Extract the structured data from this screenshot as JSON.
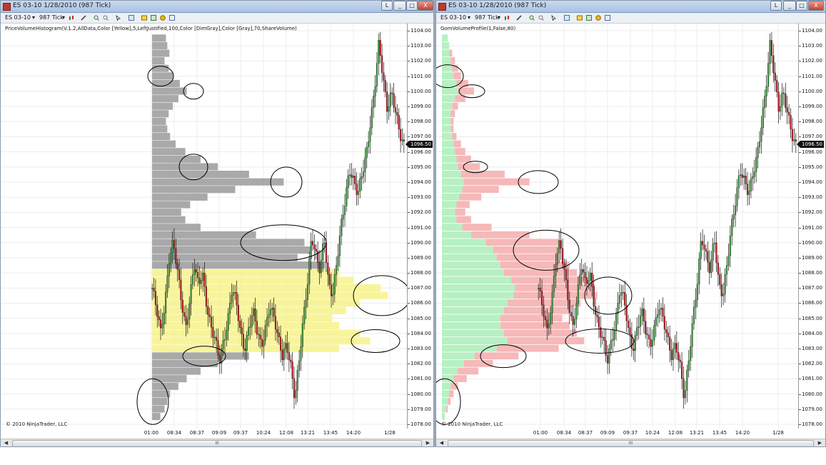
{
  "left_window": {
    "title": "ES 03-10  1/28/2010 (987 Tick)",
    "window_buttons": {
      "help": "L",
      "minimize": "_",
      "maximize": "□",
      "close": "X"
    },
    "toolbar": {
      "instrument": "ES 03-10",
      "interval": "987 Tick"
    },
    "indicator_label": "PriceVolumeHistogram(V.1.2,AllData,Color [Yellow],5,LeftJustified,100,Color [DimGray],Color [Gray],70,ShareVolume)",
    "last_price": "1096.50",
    "copyright": "© 2010 NinjaTrader, LLC",
    "scroll_thumb": "III"
  },
  "right_window": {
    "title": "ES 03-10  1/28/2010 (987 Tick)",
    "window_buttons": {
      "help": "L",
      "minimize": "_",
      "maximize": "□",
      "close": "X"
    },
    "toolbar": {
      "instrument": "ES 03-10",
      "interval": "987 Tick"
    },
    "indicator_label": "GomVolumeProfile(1,False,80)",
    "last_price": "1096.50",
    "copyright": "© 2010 NinjaTrader, LLC",
    "scroll_thumb": "III"
  },
  "colors": {
    "candle_up": "#3a9a3a",
    "candle_down": "#c0161c",
    "left_profile": "#a9a9a9",
    "left_value_area": "#f7f28a",
    "right_profile_buy": "#b7f0c3",
    "right_profile_sell": "#f6b8b8"
  },
  "chart_data": {
    "type": "candlestick",
    "price_axis_labels": [
      "1104.00",
      "1103.00",
      "1102.00",
      "1101.00",
      "1100.00",
      "1099.00",
      "1098.00",
      "1097.00",
      "1096.00",
      "1095.00",
      "1094.00",
      "1093.00",
      "1092.00",
      "1091.00",
      "1090.00",
      "1089.00",
      "1088.00",
      "1087.00",
      "1086.00",
      "1085.00",
      "1084.00",
      "1083.00",
      "1082.00",
      "1081.00",
      "1080.00",
      "1079.00",
      "1078.00"
    ],
    "ylim": [
      1078,
      1104
    ],
    "left_time_labels": [
      "01:00",
      "08:34",
      "08:37",
      "09:09",
      "09:37",
      "10:24",
      "12:08",
      "13:21",
      "13:45",
      "14:20",
      "1/28"
    ],
    "right_time_labels": [
      "01:00",
      "08:34",
      "08:37",
      "09:09",
      "09:37",
      "10:24",
      "12:08",
      "13:21",
      "13:45",
      "14:20",
      "1/28"
    ],
    "close_path": [
      [
        0,
        1087
      ],
      [
        4,
        1085.5
      ],
      [
        8,
        1084
      ],
      [
        12,
        1086
      ],
      [
        16,
        1089
      ],
      [
        20,
        1090
      ],
      [
        24,
        1088
      ],
      [
        28,
        1086
      ],
      [
        32,
        1084.5
      ],
      [
        36,
        1086.5
      ],
      [
        40,
        1088.5
      ],
      [
        44,
        1087
      ],
      [
        48,
        1088
      ],
      [
        52,
        1086
      ],
      [
        56,
        1084.5
      ],
      [
        60,
        1083.5
      ],
      [
        64,
        1082
      ],
      [
        68,
        1083.5
      ],
      [
        72,
        1085
      ],
      [
        76,
        1087
      ],
      [
        80,
        1086
      ],
      [
        84,
        1084
      ],
      [
        88,
        1083
      ],
      [
        92,
        1084.5
      ],
      [
        96,
        1085.5
      ],
      [
        100,
        1084
      ],
      [
        104,
        1083
      ],
      [
        108,
        1084.5
      ],
      [
        112,
        1086
      ],
      [
        116,
        1085
      ],
      [
        120,
        1083.5
      ],
      [
        124,
        1082.5
      ],
      [
        128,
        1083.5
      ],
      [
        132,
        1082
      ],
      [
        136,
        1079.5
      ],
      [
        140,
        1082
      ],
      [
        144,
        1085
      ],
      [
        148,
        1087.5
      ],
      [
        152,
        1090.5
      ],
      [
        156,
        1089
      ],
      [
        160,
        1088
      ],
      [
        164,
        1090.5
      ],
      [
        168,
        1087.5
      ],
      [
        172,
        1086.5
      ],
      [
        176,
        1088.5
      ],
      [
        180,
        1091
      ],
      [
        184,
        1093
      ],
      [
        188,
        1095
      ],
      [
        192,
        1094
      ],
      [
        196,
        1093
      ],
      [
        200,
        1094.5
      ],
      [
        204,
        1096
      ],
      [
        208,
        1098
      ],
      [
        212,
        1100
      ],
      [
        216,
        1103
      ],
      [
        220,
        1101
      ],
      [
        224,
        1099
      ],
      [
        228,
        1100
      ],
      [
        232,
        1098.5
      ],
      [
        236,
        1097
      ],
      [
        240,
        1096.5
      ]
    ],
    "left_volume_profile": [
      [
        1103.5,
        20
      ],
      [
        1103,
        22
      ],
      [
        1102.5,
        25
      ],
      [
        1102,
        18
      ],
      [
        1101.5,
        24
      ],
      [
        1101,
        30
      ],
      [
        1100.5,
        40
      ],
      [
        1100,
        50
      ],
      [
        1099.5,
        38
      ],
      [
        1099,
        30
      ],
      [
        1098.5,
        24
      ],
      [
        1098,
        20
      ],
      [
        1097.5,
        22
      ],
      [
        1097,
        26
      ],
      [
        1096.5,
        34
      ],
      [
        1096,
        48
      ],
      [
        1095.5,
        70
      ],
      [
        1095,
        95
      ],
      [
        1094.5,
        140
      ],
      [
        1094,
        190
      ],
      [
        1093.5,
        120
      ],
      [
        1093,
        80
      ],
      [
        1092.5,
        55
      ],
      [
        1092,
        42
      ],
      [
        1091.5,
        48
      ],
      [
        1091,
        70
      ],
      [
        1090.5,
        150
      ],
      [
        1090,
        220
      ],
      [
        1089.5,
        230
      ],
      [
        1089,
        210
      ],
      [
        1088.5,
        250
      ],
      [
        1088,
        270
      ],
      [
        1087.5,
        290
      ],
      [
        1087,
        330
      ],
      [
        1086.5,
        340
      ],
      [
        1086,
        300
      ],
      [
        1085.5,
        280
      ],
      [
        1085,
        260
      ],
      [
        1084.5,
        270
      ],
      [
        1084,
        300
      ],
      [
        1083.5,
        315
      ],
      [
        1083,
        270
      ],
      [
        1082.5,
        140
      ],
      [
        1082,
        95
      ],
      [
        1081.5,
        70
      ],
      [
        1081,
        50
      ],
      [
        1080.5,
        38
      ],
      [
        1080,
        26
      ],
      [
        1079.5,
        22
      ],
      [
        1079,
        18
      ],
      [
        1078.5,
        12
      ]
    ],
    "right_volume_profile": [
      [
        1103.5,
        8,
        0
      ],
      [
        1103,
        10,
        0
      ],
      [
        1102.5,
        10,
        4
      ],
      [
        1102,
        12,
        6
      ],
      [
        1101.5,
        14,
        8
      ],
      [
        1101,
        16,
        10
      ],
      [
        1100.5,
        20,
        16
      ],
      [
        1100,
        22,
        22
      ],
      [
        1099.5,
        18,
        14
      ],
      [
        1099,
        14,
        8
      ],
      [
        1098.5,
        12,
        6
      ],
      [
        1098,
        12,
        4
      ],
      [
        1097.5,
        12,
        4
      ],
      [
        1097,
        14,
        6
      ],
      [
        1096.5,
        16,
        10
      ],
      [
        1096,
        18,
        14
      ],
      [
        1095.5,
        20,
        20
      ],
      [
        1095,
        22,
        30
      ],
      [
        1094.5,
        26,
        60
      ],
      [
        1094,
        30,
        90
      ],
      [
        1093.5,
        28,
        50
      ],
      [
        1093,
        24,
        30
      ],
      [
        1092.5,
        20,
        18
      ],
      [
        1092,
        18,
        14
      ],
      [
        1091.5,
        20,
        20
      ],
      [
        1091,
        28,
        40
      ],
      [
        1090.5,
        40,
        80
      ],
      [
        1090,
        60,
        100
      ],
      [
        1089.5,
        70,
        90
      ],
      [
        1089,
        75,
        85
      ],
      [
        1088.5,
        80,
        95
      ],
      [
        1088,
        85,
        100
      ],
      [
        1087.5,
        95,
        105
      ],
      [
        1087,
        100,
        110
      ],
      [
        1086.5,
        98,
        115
      ],
      [
        1086,
        90,
        100
      ],
      [
        1085.5,
        85,
        90
      ],
      [
        1085,
        80,
        85
      ],
      [
        1084.5,
        80,
        95
      ],
      [
        1084,
        85,
        100
      ],
      [
        1083.5,
        90,
        105
      ],
      [
        1083,
        75,
        85
      ],
      [
        1082.5,
        45,
        60
      ],
      [
        1082,
        30,
        40
      ],
      [
        1081.5,
        22,
        28
      ],
      [
        1081,
        16,
        18
      ],
      [
        1080.5,
        12,
        10
      ],
      [
        1080,
        10,
        6
      ],
      [
        1079.5,
        8,
        4
      ],
      [
        1079,
        6,
        2
      ],
      [
        1078.5,
        4,
        0
      ]
    ]
  }
}
